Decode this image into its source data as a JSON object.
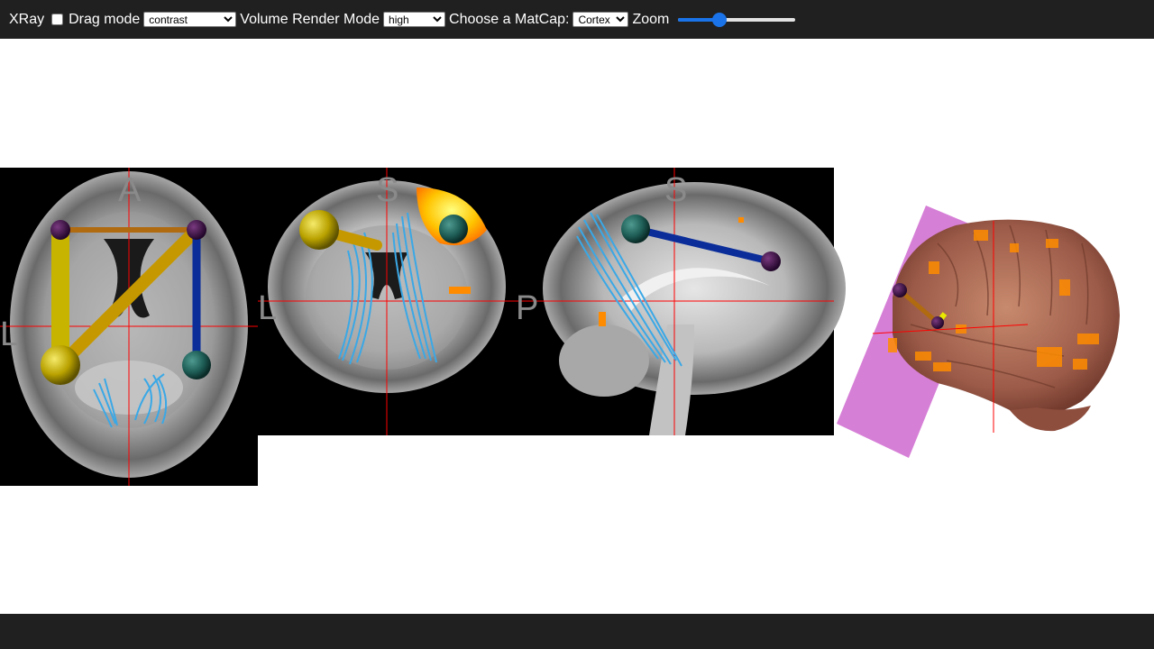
{
  "toolbar": {
    "xray_label": "XRay",
    "xray_checked": false,
    "drag_label": "Drag mode",
    "drag_value": "contrast",
    "volume_label": "Volume Render Mode",
    "volume_value": "high",
    "matcap_label": "Choose a MatCap:",
    "matcap_value": "Cortex",
    "zoom_label": "Zoom",
    "zoom_fraction": 0.35
  },
  "views": {
    "axial": {
      "top": "A",
      "left": "L"
    },
    "coronal": {
      "top": "S",
      "left": "L"
    },
    "sagittal": {
      "top": "S",
      "left": "P"
    }
  },
  "colors": {
    "toolbar_bg": "#202020",
    "crosshair": "#ff0000",
    "slider_accent": "#1a73e8",
    "fiber": "#3aa8e6",
    "activation": "#ff8c00",
    "node_yellow": "#c8b400",
    "node_teal": "#1f5f58",
    "node_purple": "#3a0f3f",
    "edge_blue": "#0a2d9a",
    "clip_plane": "#d67fd6"
  }
}
